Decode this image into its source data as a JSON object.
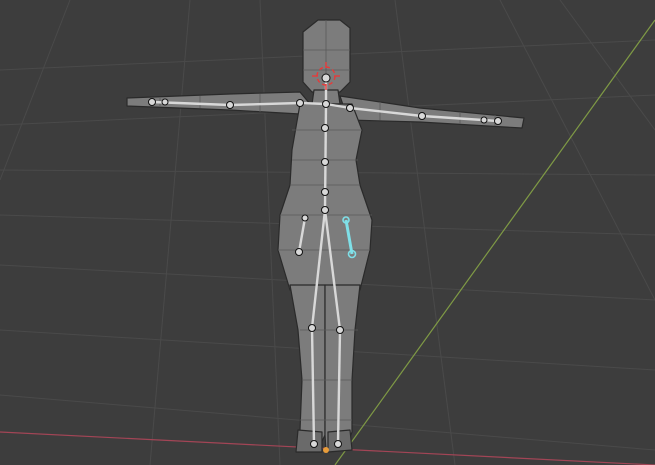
{
  "viewport": {
    "background": "#3d3d3d",
    "grid_color": "#4a4a4a",
    "x_axis_color": "#a34556",
    "y_axis_color": "#7f9a45"
  },
  "mesh": {
    "fill": "#7c7c7c",
    "shade": "#6a6a6a",
    "edge_color": "#5a5a5a",
    "outline_color": "#2a2a2a"
  },
  "armature": {
    "bone_color": "#d8d8d8",
    "bone_outline": "#111111",
    "selected_bone_color": "#7fe0e8"
  },
  "cursor_3d": {
    "color": "#e63a3a",
    "icon": "3d-cursor-icon"
  },
  "origin": {
    "color": "#e89c3a",
    "icon": "origin-dot-icon"
  }
}
